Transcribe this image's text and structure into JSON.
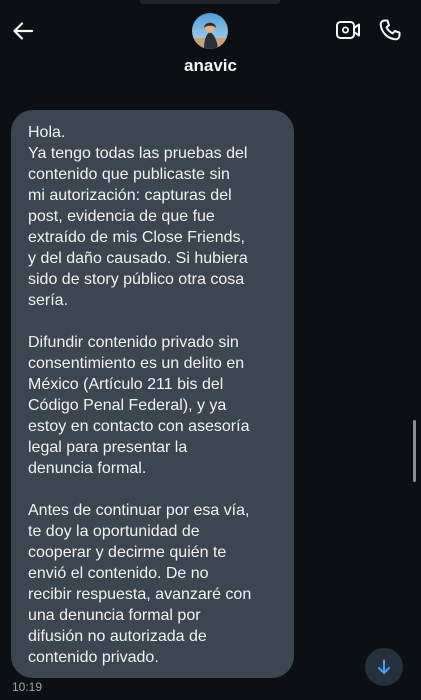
{
  "header": {
    "username": "anavic",
    "icons": {
      "back": "arrow-left-icon",
      "video": "video-camera-icon",
      "phone": "phone-icon"
    }
  },
  "message": {
    "paragraphs": [
      "Hola.\nYa tengo todas las pruebas del\ncontenido que publicaste sin\nmi autorización: capturas del\npost, evidencia de que fue\nextraído de mis Close Friends,\ny del daño causado. Si hubiera\nsido de story público otra cosa\nsería.",
      "Difundir contenido privado sin\nconsentimiento es un delito en\nMéxico (Artículo 211 bis del\nCódigo Penal Federal), y ya\nestoy en contacto con asesoría\nlegal para presentar la\ndenuncia formal.",
      "Antes de continuar por esa vía,\nte doy la oportunidad de\ncooperar y decirme quién te\nenvió el contenido. De no\nrecibir respuesta, avanzaré con\nuna denuncia formal por\ndifusión no autorizada de\ncontenido privado."
    ],
    "timestamp": "10:19"
  },
  "colors": {
    "background": "#0c1014",
    "bubble": "#3b4650",
    "scroll_button": "#24313d",
    "scroll_arrow": "#4a9eff"
  }
}
